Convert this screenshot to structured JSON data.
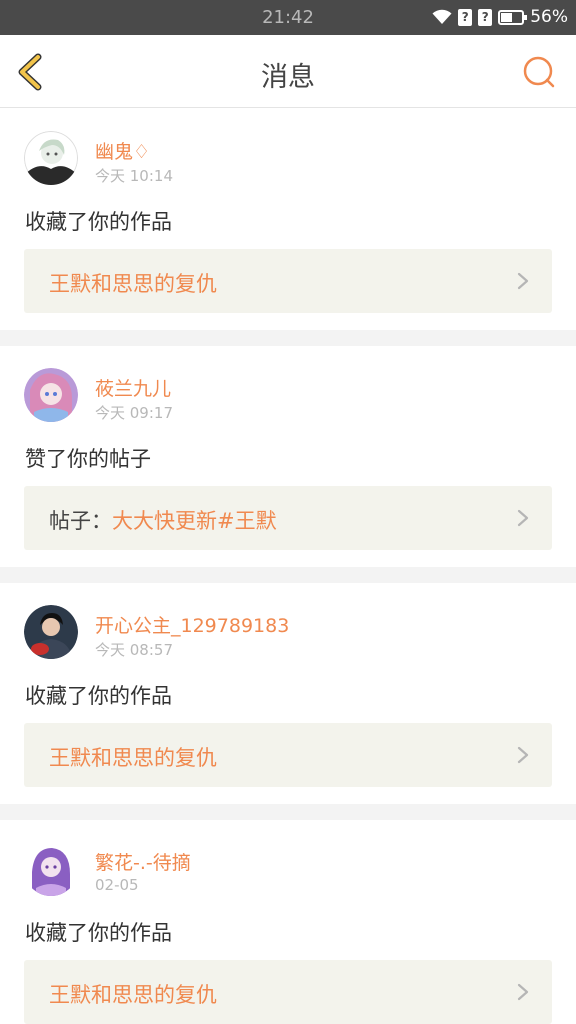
{
  "status_bar": {
    "time": "21:42",
    "battery": "56%",
    "battery_level": 0.56
  },
  "header": {
    "title": "消息",
    "back_icon": "chevron-left-icon",
    "search_icon": "search-icon"
  },
  "colors": {
    "accent": "#f0894f",
    "back_icon": "#f2c44a",
    "panel": "#f3f3ec"
  },
  "messages": [
    {
      "user": "幽鬼♢",
      "time": "今天 10:14",
      "action": "收藏了你的作品",
      "ref_prefix": "",
      "ref_title": "王默和思思的复仇"
    },
    {
      "user": "莜兰九儿",
      "time": "今天 09:17",
      "action": "赞了你的帖子",
      "ref_prefix": "帖子：",
      "ref_title": "大大快更新#王默"
    },
    {
      "user": "开心公主_129789183",
      "time": "今天 08:57",
      "action": "收藏了你的作品",
      "ref_prefix": "",
      "ref_title": "王默和思思的复仇"
    },
    {
      "user": "繁花-.-待摘",
      "time": "02-05",
      "action": "收藏了你的作品",
      "ref_prefix": "",
      "ref_title": "王默和思思的复仇"
    }
  ]
}
